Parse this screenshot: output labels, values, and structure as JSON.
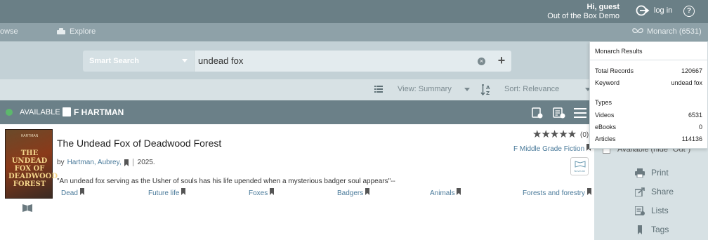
{
  "header": {
    "greeting": "Hi, guest",
    "library": "Out of the Box Demo",
    "login_label": "log in",
    "help_label": "?"
  },
  "nav": {
    "browse": "owse",
    "explore": "Explore",
    "monarch": "Monarch (6531)"
  },
  "search": {
    "scope": "Smart Search",
    "query": "undead fox",
    "clear": "×",
    "add": "+"
  },
  "options": {
    "view": "View: Summary",
    "sort": "Sort: Relevance"
  },
  "availability": {
    "status": "AVAILABLE",
    "call_number": "F HARTMAN"
  },
  "record": {
    "cover_author": "HARTMAN",
    "cover_title": "THE UNDEAD FOX OF DEADWOOD FOREST",
    "title": "The Undead Fox of Deadwood Forest",
    "by": "by",
    "author": "Hartman, Aubrey,",
    "year": "2025.",
    "summary": "\"An undead fox serving as the Usher of souls has his life upended when a mysterious badger soul appears\"--",
    "subjects": [
      "Dead",
      "Future life",
      "Foxes",
      "Badgers",
      "Animals",
      "Forests and forestry"
    ],
    "rating_stars": "★★★★★",
    "rating_count": "(0)",
    "genre": "F Middle Grade Fiction",
    "novelist_label": "NoveList"
  },
  "side": {
    "available_only": "Available (hide \"Out\")",
    "print": "Print",
    "share": "Share",
    "lists": "Lists",
    "tags": "Tags"
  },
  "monarch_popup": {
    "title": "Monarch Results",
    "total_label": "Total Records",
    "total_value": "120667",
    "keyword_label": "Keyword",
    "keyword_value": "undead fox",
    "types_label": "Types",
    "types": [
      {
        "label": "Videos",
        "value": "6531"
      },
      {
        "label": "eBooks",
        "value": "0"
      },
      {
        "label": "Articles",
        "value": "114136"
      }
    ]
  }
}
